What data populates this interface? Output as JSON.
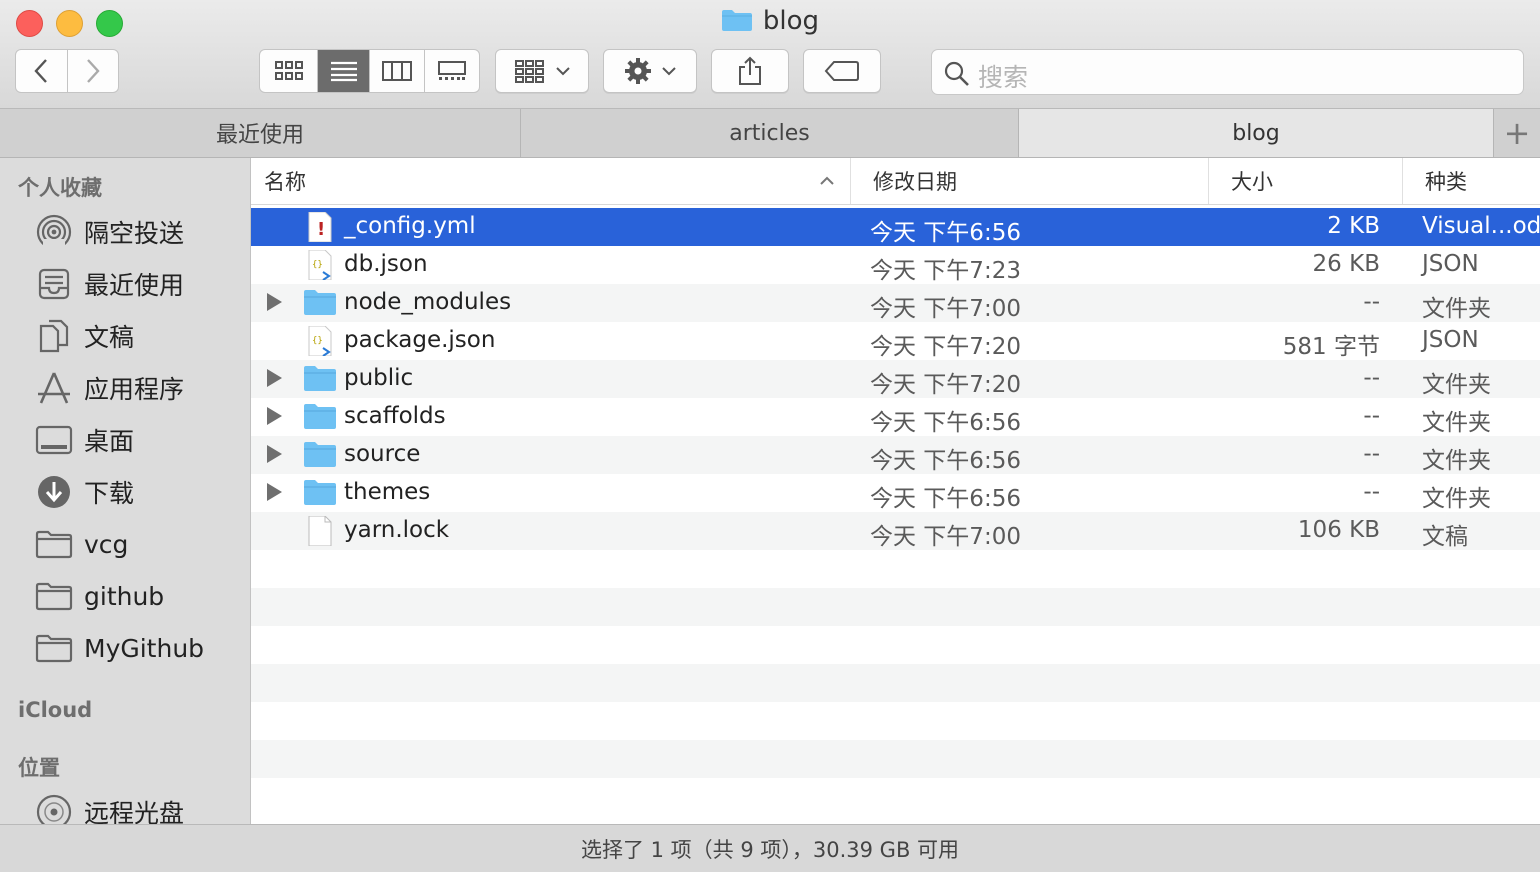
{
  "window": {
    "title": "blog"
  },
  "toolbar": {
    "search_placeholder": "搜索"
  },
  "tabs": [
    {
      "label": "最近使用",
      "active": false
    },
    {
      "label": "articles",
      "active": false
    },
    {
      "label": "blog",
      "active": true
    }
  ],
  "sidebar": {
    "favorites_header": "个人收藏",
    "favorites": [
      {
        "label": "隔空投送",
        "icon": "airdrop-icon"
      },
      {
        "label": "最近使用",
        "icon": "recents-icon"
      },
      {
        "label": "文稿",
        "icon": "documents-icon"
      },
      {
        "label": "应用程序",
        "icon": "applications-icon"
      },
      {
        "label": "桌面",
        "icon": "desktop-icon"
      },
      {
        "label": "下载",
        "icon": "downloads-icon"
      },
      {
        "label": "vcg",
        "icon": "folder-icon"
      },
      {
        "label": "github",
        "icon": "folder-icon"
      },
      {
        "label": "MyGithub",
        "icon": "folder-icon"
      }
    ],
    "icloud_header": "iCloud",
    "locations_header": "位置",
    "locations": [
      {
        "label": "远程光盘",
        "icon": "remote-disc-icon"
      }
    ]
  },
  "columns": {
    "name": "名称",
    "date": "修改日期",
    "size": "大小",
    "kind": "种类"
  },
  "files": [
    {
      "name": "_config.yml",
      "date": "今天 下午6:56",
      "size": "2 KB",
      "kind": "Visual...ode",
      "type": "yml",
      "selected": true
    },
    {
      "name": "db.json",
      "date": "今天 下午7:23",
      "size": "26 KB",
      "kind": "JSON",
      "type": "json",
      "selected": false
    },
    {
      "name": "node_modules",
      "date": "今天 下午7:00",
      "size": "--",
      "kind": "文件夹",
      "type": "folder",
      "selected": false
    },
    {
      "name": "package.json",
      "date": "今天 下午7:20",
      "size": "581 字节",
      "kind": "JSON",
      "type": "json",
      "selected": false
    },
    {
      "name": "public",
      "date": "今天 下午7:20",
      "size": "--",
      "kind": "文件夹",
      "type": "folder",
      "selected": false
    },
    {
      "name": "scaffolds",
      "date": "今天 下午6:56",
      "size": "--",
      "kind": "文件夹",
      "type": "folder",
      "selected": false
    },
    {
      "name": "source",
      "date": "今天 下午6:56",
      "size": "--",
      "kind": "文件夹",
      "type": "folder",
      "selected": false
    },
    {
      "name": "themes",
      "date": "今天 下午6:56",
      "size": "--",
      "kind": "文件夹",
      "type": "folder",
      "selected": false
    },
    {
      "name": "yarn.lock",
      "date": "今天 下午7:00",
      "size": "106 KB",
      "kind": "文稿",
      "type": "doc",
      "selected": false
    }
  ],
  "status": {
    "text": "选择了 1 项（共 9 项），30.39 GB 可用"
  },
  "colors": {
    "selection": "#2962d9",
    "folder": "#6ec1f3"
  }
}
